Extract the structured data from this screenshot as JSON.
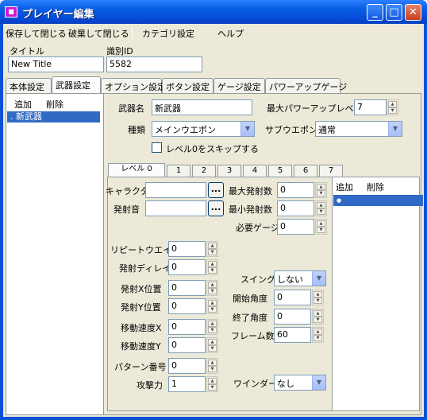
{
  "window": {
    "title": "プレイヤー編集",
    "icon": "app-icon",
    "min": "_",
    "max": "□",
    "close": "✕"
  },
  "menu": {
    "save_close": "保存して閉じる",
    "discard_close": "破棄して閉じる",
    "category": "カテゴリ設定",
    "help": "ヘルプ"
  },
  "header": {
    "title_label": "タイトル",
    "title_value": "New Title",
    "id_label": "識別ID",
    "id_value": "5582"
  },
  "tabs": [
    "本体設定",
    "武器設定",
    "オプション設定",
    "ボタン設定",
    "ゲージ設定",
    "パワーアップゲージ"
  ],
  "weapon_list": {
    "add": "追加",
    "delete": "削除",
    "items": [
      "新武器"
    ]
  },
  "weapon": {
    "name_label": "武器名",
    "name_value": "新武器",
    "max_power_label": "最大パワーアップレベル",
    "max_power_value": "7",
    "type_label": "種類",
    "type_value": "メインウエポン",
    "sub_label": "サブウエポン",
    "sub_value": "通常",
    "skip_label": "レベル0をスキップする"
  },
  "level_tabs": [
    "レベル 0",
    "1",
    "2",
    "3",
    "4",
    "5",
    "6",
    "7"
  ],
  "level": {
    "chara_label": "キャラクタ",
    "chara_value": "",
    "sound_label": "発射音",
    "sound_value": "",
    "browse": "...",
    "max_shots_label": "最大発射数",
    "max_shots_value": "0",
    "min_shots_label": "最小発射数",
    "min_shots_value": "0",
    "gauge_label": "必要ゲージ",
    "gauge_value": "0",
    "repeat_label": "リピートウエイト",
    "repeat_value": "0",
    "delay_label": "発射ディレイ",
    "delay_value": "0",
    "posx_label": "発射X位置",
    "posx_value": "0",
    "posy_label": "発射Y位置",
    "posy_value": "0",
    "speedx_label": "移動速度X",
    "speedx_value": "0",
    "speedy_label": "移動速度Y",
    "speedy_value": "0",
    "pattern_label": "パターン番号",
    "pattern_value": "0",
    "attack_label": "攻撃力",
    "attack_value": "1",
    "swing_label": "スイング",
    "swing_value": "しない",
    "start_angle_label": "開始角度",
    "start_angle_value": "0",
    "end_angle_label": "終了角度",
    "end_angle_value": "0",
    "frames_label": "フレーム数",
    "frames_value": "60",
    "winder_label": "ワインダー",
    "winder_value": "なし"
  },
  "level_list": {
    "add": "追加",
    "delete": "削除",
    "items": [
      "●"
    ]
  }
}
